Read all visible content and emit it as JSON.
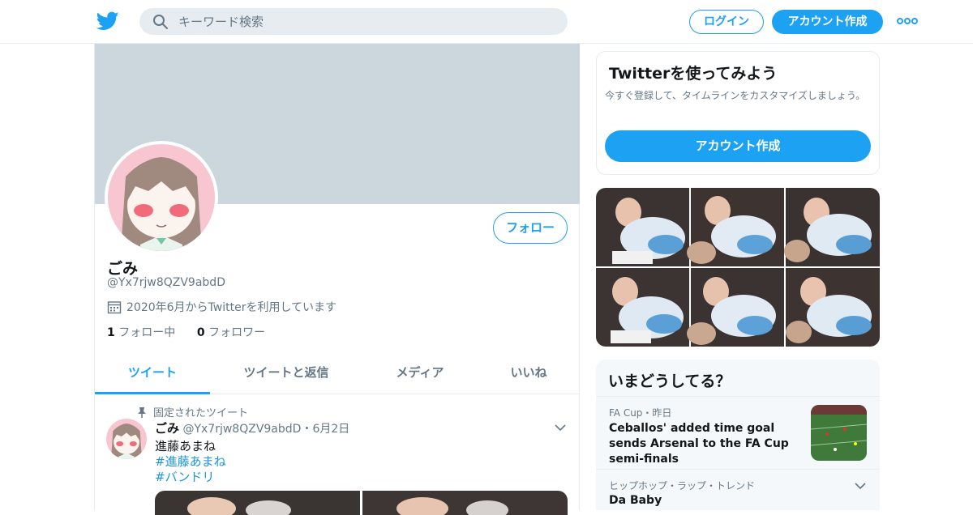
{
  "nav": {
    "search_placeholder": "キーワード検索",
    "login_label": "ログイン",
    "signup_label": "アカウント作成",
    "brand_color": "#1da1f2"
  },
  "profile": {
    "name": "ごみ",
    "handle": "@Yx7rjw8QZV9abdD",
    "joined": "2020年6月からTwitterを利用しています",
    "following_count": "1",
    "following_label": "フォロー中",
    "followers_count": "0",
    "followers_label": "フォロワー",
    "follow_button": "フォロー"
  },
  "tabs": [
    {
      "label": "ツイート",
      "active": true
    },
    {
      "label": "ツイートと返信",
      "active": false
    },
    {
      "label": "メディア",
      "active": false
    },
    {
      "label": "いいね",
      "active": false
    }
  ],
  "tweet": {
    "pinned_label": "固定されたツイート",
    "author_name": "ごみ",
    "author_handle": "@Yx7rjw8QZV9abdD",
    "date": "・6月2日",
    "text": "進藤あまね",
    "hashtags": [
      "#進藤あまね",
      "#バンドリ"
    ]
  },
  "signup_card": {
    "title": "Twitterを使ってみよう",
    "description": "今すぐ登録して、タイムラインをカスタマイズしましょう。",
    "button": "アカウント作成"
  },
  "trends": {
    "title": "いまどうしてる？",
    "items": [
      {
        "meta": "FA Cup・昨日",
        "headline": "Ceballos' added time goal sends Arsenal to the FA Cup semi-finals"
      },
      {
        "meta": "ヒップホップ・ラップ・トレンド",
        "headline": "Da Baby"
      }
    ]
  }
}
